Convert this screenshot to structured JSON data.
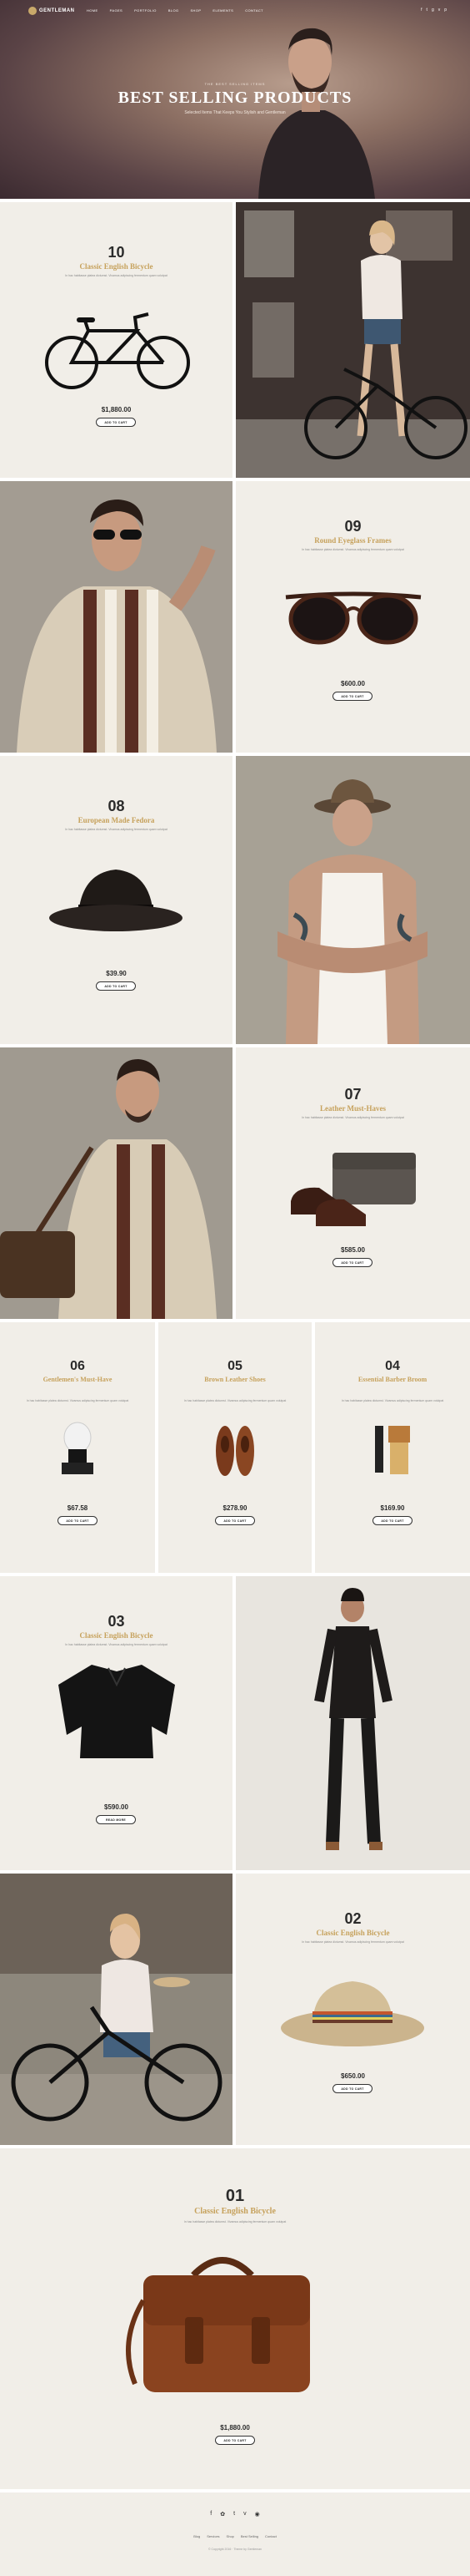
{
  "brand": {
    "name": "GENTLEMAN"
  },
  "nav": {
    "items": [
      "HOME",
      "PAGES",
      "PORTFOLIO",
      "BLOG",
      "SHOP",
      "ELEMENTS",
      "CONTACT"
    ]
  },
  "social_top": [
    "f",
    "t",
    "g",
    "v",
    "p"
  ],
  "hero": {
    "kicker": "THE BEST SELLING ITEMS",
    "title": "BEST SELLING PRODUCTS",
    "subtitle": "Selected Items That Keeps You Stylish and Gentleman"
  },
  "products": [
    {
      "num": "10",
      "name": "Classic English Bicycle",
      "desc": "In hac habitasse platea dictumst. Vivamus adipiscing fermentum quam volutpat",
      "price": "$1,880.00",
      "button": "ADD TO CART"
    },
    {
      "num": "09",
      "name": "Round Eyeglass Frames",
      "desc": "In hac habitasse platea dictumst. Vivamus adipiscing fermentum quam volutpat",
      "price": "$600.00",
      "button": "ADD TO CART"
    },
    {
      "num": "08",
      "name": "European Made Fedora",
      "desc": "In hac habitasse platea dictumst. Vivamus adipiscing fermentum quam volutpat",
      "price": "$39.90",
      "button": "ADD TO CART"
    },
    {
      "num": "07",
      "name": "Leather Must-Haves",
      "desc": "In hac habitasse platea dictumst. Vivamus adipiscing fermentum quam volutpat",
      "price": "$585.00",
      "button": "ADD TO CART"
    },
    {
      "num": "06",
      "name": "Gentlemen's Must-Have",
      "desc": "In hac habitasse platea dictumst. Vivamus adipiscing fermentum quam volutpat",
      "price": "$67.58",
      "button": "ADD TO CART"
    },
    {
      "num": "05",
      "name": "Brown Leather Shoes",
      "desc": "In hac habitasse platea dictumst. Vivamus adipiscing fermentum quam volutpat",
      "price": "$278.90",
      "button": "ADD TO CART"
    },
    {
      "num": "04",
      "name": "Essential Barber Broom",
      "desc": "In hac habitasse platea dictumst. Vivamus adipiscing fermentum quam volutpat",
      "price": "$169.90",
      "button": "ADD TO CART"
    },
    {
      "num": "03",
      "name": "Classic English Bicycle",
      "desc": "In hac habitasse platea dictumst. Vivamus adipiscing fermentum quam volutpat",
      "price": "$590.00",
      "button": "READ MORE"
    },
    {
      "num": "02",
      "name": "Classic English Bicycle",
      "desc": "In hac habitasse platea dictumst. Vivamus adipiscing fermentum quam volutpat",
      "price": "$650.00",
      "button": "ADD TO CART"
    },
    {
      "num": "01",
      "name": "Classic English Bicycle",
      "desc": "In hac habitasse platea dictumst. Vivamus adipiscing fermentum quam volutpat",
      "price": "$1,880.00",
      "button": "ADD TO CART"
    }
  ],
  "footer": {
    "social": [
      "f",
      "✿",
      "t",
      "v",
      "◉"
    ],
    "links": [
      "Blog",
      "Services",
      "Shop",
      "Best Selling",
      "Contact"
    ],
    "copyright": "© Copyright 2016 · Theme by Gentleman"
  },
  "colors": {
    "accent": "#c6a15b",
    "panel": "#f1eee8"
  }
}
